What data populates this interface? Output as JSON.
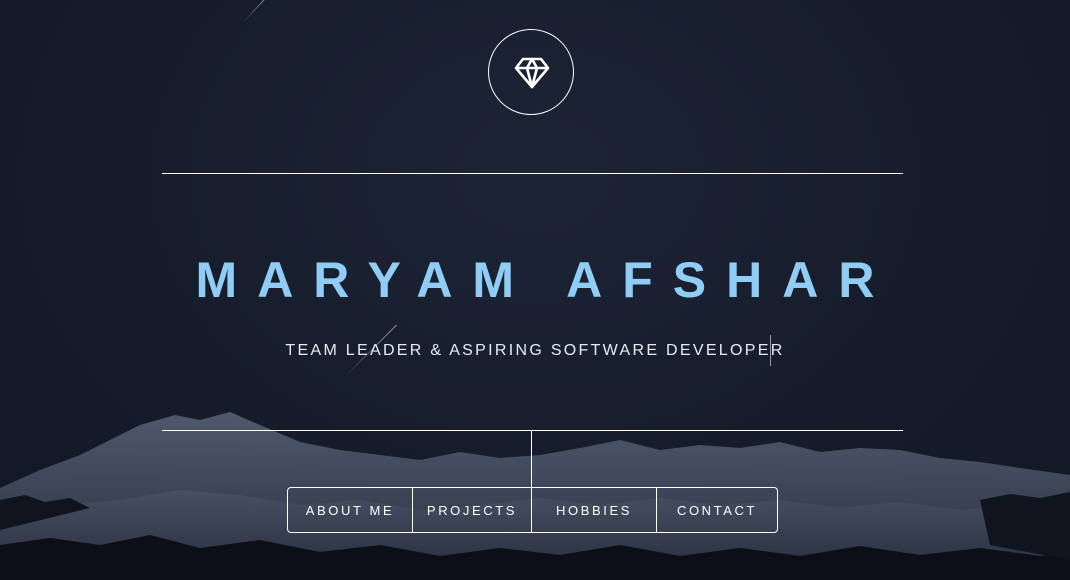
{
  "header": {
    "logo_icon": "diamond-icon"
  },
  "hero": {
    "name": "MARYAM AFSHAR",
    "subtitle": "TEAM LEADER & ASPIRING SOFTWARE DEVELOPER"
  },
  "nav": {
    "items": [
      {
        "label": "ABOUT ME"
      },
      {
        "label": "PROJECTS"
      },
      {
        "label": "HOBBIES"
      },
      {
        "label": "CONTACT"
      }
    ]
  },
  "colors": {
    "background": "#161c2b",
    "name_accent": "#8fcdf4",
    "lines": "#ffffff"
  }
}
